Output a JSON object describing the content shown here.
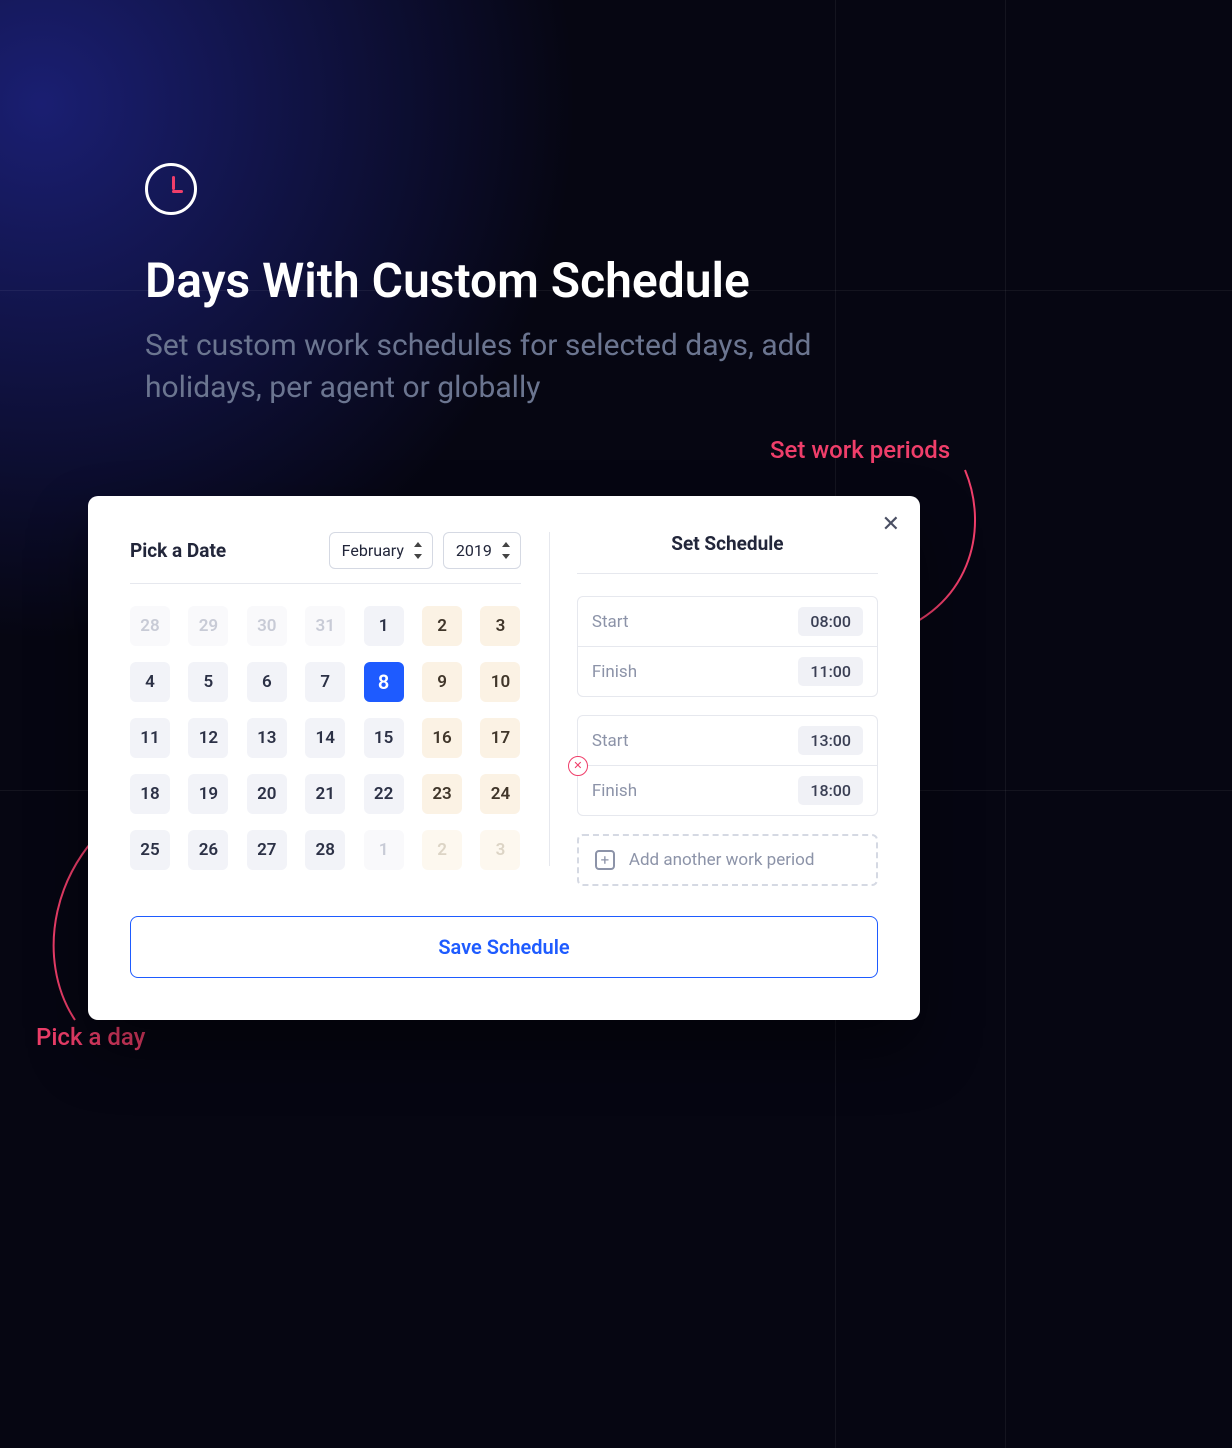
{
  "header": {
    "title": "Days With Custom Schedule",
    "subtitle": "Set custom work schedules for selected days, add holidays, per agent or globally"
  },
  "annotations": {
    "set_work_periods": "Set work periods",
    "pick_a_day": "Pick a day"
  },
  "dialog": {
    "pick_date_title": "Pick a Date",
    "month": "February",
    "year": "2019",
    "set_schedule_title": "Set Schedule",
    "calendar": [
      {
        "d": "28",
        "style": "muted"
      },
      {
        "d": "29",
        "style": "muted"
      },
      {
        "d": "30",
        "style": "muted"
      },
      {
        "d": "31",
        "style": "muted"
      },
      {
        "d": "1",
        "style": "normal"
      },
      {
        "d": "2",
        "style": "weekend"
      },
      {
        "d": "3",
        "style": "weekend"
      },
      {
        "d": "4",
        "style": "normal"
      },
      {
        "d": "5",
        "style": "normal"
      },
      {
        "d": "6",
        "style": "normal"
      },
      {
        "d": "7",
        "style": "normal"
      },
      {
        "d": "8",
        "style": "selected"
      },
      {
        "d": "9",
        "style": "weekend"
      },
      {
        "d": "10",
        "style": "weekend"
      },
      {
        "d": "11",
        "style": "normal"
      },
      {
        "d": "12",
        "style": "normal"
      },
      {
        "d": "13",
        "style": "normal"
      },
      {
        "d": "14",
        "style": "normal"
      },
      {
        "d": "15",
        "style": "normal"
      },
      {
        "d": "16",
        "style": "weekend"
      },
      {
        "d": "17",
        "style": "weekend"
      },
      {
        "d": "18",
        "style": "normal"
      },
      {
        "d": "19",
        "style": "normal"
      },
      {
        "d": "20",
        "style": "normal"
      },
      {
        "d": "21",
        "style": "normal"
      },
      {
        "d": "22",
        "style": "normal"
      },
      {
        "d": "23",
        "style": "weekend"
      },
      {
        "d": "24",
        "style": "weekend"
      },
      {
        "d": "25",
        "style": "normal"
      },
      {
        "d": "26",
        "style": "normal"
      },
      {
        "d": "27",
        "style": "normal"
      },
      {
        "d": "28",
        "style": "normal"
      },
      {
        "d": "1",
        "style": "muted"
      },
      {
        "d": "2",
        "style": "weekend muted"
      },
      {
        "d": "3",
        "style": "weekend muted"
      }
    ],
    "periods": [
      {
        "start_label": "Start",
        "start_time": "08:00",
        "finish_label": "Finish",
        "finish_time": "11:00",
        "removable": false
      },
      {
        "start_label": "Start",
        "start_time": "13:00",
        "finish_label": "Finish",
        "finish_time": "18:00",
        "removable": true
      }
    ],
    "add_period_label": "Add another work period",
    "save_label": "Save Schedule"
  },
  "colors": {
    "accent_blue": "#1e5bff",
    "accent_pink": "#ef3e6a"
  }
}
